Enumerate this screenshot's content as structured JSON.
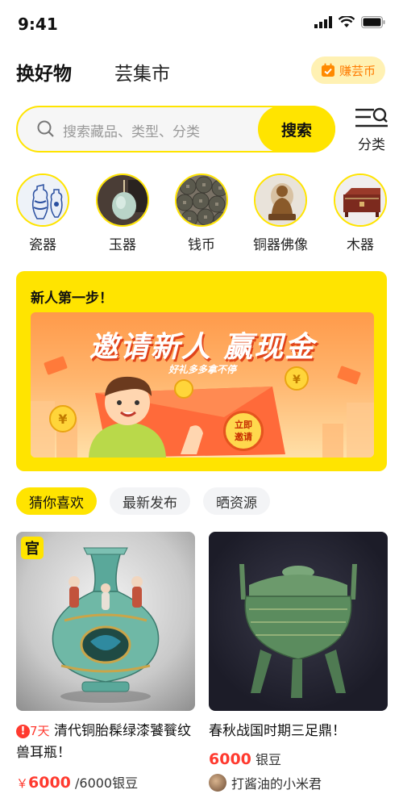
{
  "status": {
    "time": "9:41"
  },
  "top_tabs": {
    "active": "换好物",
    "secondary": "芸集市",
    "earn_label": "赚芸币"
  },
  "search": {
    "placeholder": "搜索藏品、类型、分类",
    "button_label": "搜索",
    "category_label": "分类"
  },
  "categories": [
    {
      "label": "瓷器",
      "icon": "porcelain-icon"
    },
    {
      "label": "玉器",
      "icon": "jade-icon"
    },
    {
      "label": "钱币",
      "icon": "coin-icon"
    },
    {
      "label": "铜器佛像",
      "icon": "bronze-buddha-icon"
    },
    {
      "label": "木器",
      "icon": "wood-icon"
    }
  ],
  "promo": {
    "title": "新人第一步！",
    "banner_title": "邀请新人 赢现金",
    "banner_subtitle": "好礼多多拿不停",
    "invite_label_line1": "立即",
    "invite_label_line2": "邀请"
  },
  "feed_tabs": [
    "猜你喜欢",
    "最新发布",
    "晒资源"
  ],
  "products": [
    {
      "badge": "官",
      "days_left": "7天",
      "title": "清代铜胎髹绿漆饕餮纹兽耳瓶！",
      "currency": "￥",
      "price": "6000",
      "alt_price": "/6000银豆"
    },
    {
      "title": "春秋战国时期三足鼎！",
      "price": "6000",
      "unit": "银豆",
      "seller": "打酱油的小米君"
    }
  ],
  "colors": {
    "accent": "#ffe400",
    "price": "#ff3a2f",
    "earn_bg": "#fff1b3",
    "earn_text": "#ff7a00"
  }
}
